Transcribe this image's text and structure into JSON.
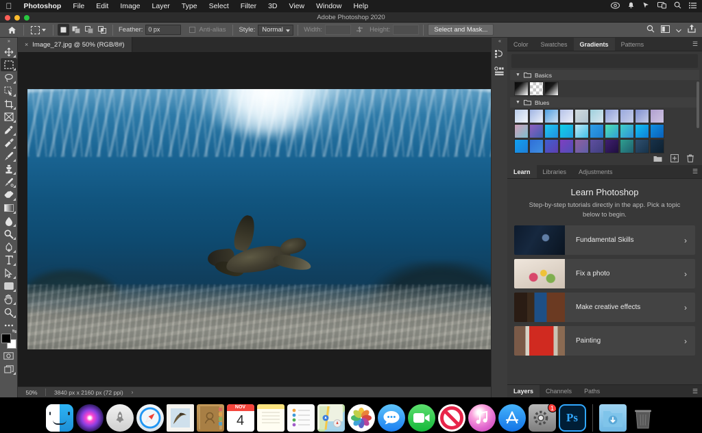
{
  "macmenu": {
    "apple_icon": "apple-icon",
    "items": [
      {
        "label": "Photoshop",
        "bold": true
      },
      {
        "label": "File",
        "bold": false
      },
      {
        "label": "Edit",
        "bold": false
      },
      {
        "label": "Image",
        "bold": false
      },
      {
        "label": "Layer",
        "bold": false
      },
      {
        "label": "Type",
        "bold": false
      },
      {
        "label": "Select",
        "bold": false
      },
      {
        "label": "Filter",
        "bold": false
      },
      {
        "label": "3D",
        "bold": false
      },
      {
        "label": "View",
        "bold": false
      },
      {
        "label": "Window",
        "bold": false
      },
      {
        "label": "Help",
        "bold": false
      }
    ],
    "status_icons": [
      "creative-cloud-icon",
      "notification-bell-icon",
      "control-center-icon",
      "screen-mirroring-icon",
      "spotlight-search-icon",
      "notification-center-icon"
    ]
  },
  "titlebar": {
    "title": "Adobe Photoshop 2020",
    "buttons": [
      "close-button",
      "minimize-button",
      "zoom-button"
    ]
  },
  "optionsbar": {
    "home_icon": "home-icon",
    "tool_icon": "rectangular-marquee-icon",
    "selection_modes": [
      "new-selection",
      "add-to-selection",
      "subtract-from-selection",
      "intersect-selection"
    ],
    "feather_label": "Feather:",
    "feather_value": "0 px",
    "antialias_label": "Anti-alias",
    "style_label": "Style:",
    "style_value": "Normal",
    "width_label": "Width:",
    "width_value": "",
    "swap_icon": "swap-dimensions-icon",
    "height_label": "Height:",
    "height_value": "",
    "select_and_mask": "Select and Mask...",
    "right_icons": [
      "search-icon",
      "workspace-icon",
      "chevron-down-icon",
      "share-icon"
    ]
  },
  "toolbar": {
    "tools": [
      {
        "name": "move-tool",
        "active": false
      },
      {
        "name": "rectangular-marquee-tool",
        "active": true
      },
      {
        "name": "lasso-tool",
        "active": false
      },
      {
        "name": "quick-selection-tool",
        "active": false
      },
      {
        "name": "crop-tool",
        "active": false
      },
      {
        "name": "frame-tool",
        "active": false
      },
      {
        "name": "eyedropper-tool",
        "active": false
      },
      {
        "name": "spot-healing-brush-tool",
        "active": false
      },
      {
        "name": "brush-tool",
        "active": false
      },
      {
        "name": "clone-stamp-tool",
        "active": false
      },
      {
        "name": "history-brush-tool",
        "active": false
      },
      {
        "name": "eraser-tool",
        "active": false
      },
      {
        "name": "gradient-tool",
        "active": false
      },
      {
        "name": "blur-tool",
        "active": false
      },
      {
        "name": "dodge-tool",
        "active": false
      },
      {
        "name": "pen-tool",
        "active": false
      },
      {
        "name": "type-tool",
        "active": false
      },
      {
        "name": "path-selection-tool",
        "active": false
      },
      {
        "name": "rectangle-tool",
        "active": false
      },
      {
        "name": "hand-tool",
        "active": false
      },
      {
        "name": "zoom-tool",
        "active": false
      },
      {
        "name": "edit-toolbar-tool",
        "active": false
      }
    ],
    "foreground_color": "#000000",
    "background_color": "#ffffff",
    "quickmask_icon": "quick-mask-icon",
    "screenmode_icon": "screen-mode-icon"
  },
  "document": {
    "tab_title": "Image_27.jpg @ 50% (RGB/8#)",
    "close_icon": "close-tab-icon"
  },
  "statusbar": {
    "zoom": "50%",
    "dimensions": "3840 px x 2160 px (72 ppi)",
    "arrow": "›"
  },
  "canvas": {
    "image_description": "Underwater photo of a sea turtle swimming above a sandy seabed with sun rays through the water surface"
  },
  "rail": {
    "icons": [
      "history-panel-icon",
      "actions-panel-icon"
    ]
  },
  "gradients_panel": {
    "tabs": [
      {
        "label": "Color",
        "active": false
      },
      {
        "label": "Swatches",
        "active": false
      },
      {
        "label": "Gradients",
        "active": true
      },
      {
        "label": "Patterns",
        "active": false
      }
    ],
    "menu_icon": "panel-menu-icon",
    "groups": [
      {
        "name": "Basics",
        "folder_icon": "folder-icon",
        "collapse_icon": "chevron-down-icon",
        "swatches": [
          "linear-gradient(135deg,#0b0b0b 0%,#111 30%,#ffffff 100%)",
          "repeating-conic-gradient(#cfcfcf 0% 25%, #ffffff 0% 50%) 0 0/9px 9px",
          "linear-gradient(135deg,#0b0b0b 0%,#1a1a1a 42%,#ffffff 100%)"
        ]
      },
      {
        "name": "Blues",
        "folder_icon": "folder-icon",
        "collapse_icon": "chevron-down-icon",
        "swatches": [
          "linear-gradient(135deg,#b9cbe8,#f3f7fb)",
          "linear-gradient(135deg,#9fb4e2,#eef2fb)",
          "linear-gradient(135deg,#4f9fe0,#cfe0f3)",
          "linear-gradient(135deg,#b6c3e8,#eceff9)",
          "linear-gradient(135deg,#cfd9dd,#b2c4cf)",
          "linear-gradient(135deg,#9fd0dd,#d8e6ef)",
          "linear-gradient(135deg,#8f9fd8,#cfd7ef)",
          "linear-gradient(135deg,#9aa9dd,#c6cde9)",
          "linear-gradient(135deg,#7f8fcf,#c4cbe6)",
          "linear-gradient(135deg,#b09fd0,#cfc4e2)",
          "linear-gradient(135deg,#cf9fb8,#7fbfcf)",
          "linear-gradient(135deg,#8f5fc0,#3f5fb0)",
          "linear-gradient(135deg,#1fc8f0,#1f8fe0)",
          "linear-gradient(135deg,#10cfe8,#1fa0e0)",
          "linear-gradient(135deg,#bfe8f5,#3fc0e8)",
          "linear-gradient(135deg,#2f9fe8,#1f7fd0)",
          "linear-gradient(135deg,#4fe0b0,#2f9fd8)",
          "linear-gradient(135deg,#3fd0c8,#2f90d8)",
          "linear-gradient(135deg,#10c0f0,#0f7fd8)",
          "linear-gradient(135deg,#0f8fe0,#0a5fb8)",
          "linear-gradient(135deg,#10a0f0,#1f7fd8)",
          "linear-gradient(135deg,#2f6fd8,#3f8fe0)",
          "linear-gradient(135deg,#3f5fd0,#5f3fb0)",
          "linear-gradient(135deg,#7f3fc0,#4f4fb8)",
          "linear-gradient(135deg,#8f5f9f,#5f5fa8)",
          "linear-gradient(135deg,#5f4f9f,#3f3f7f)",
          "linear-gradient(135deg,#3f1f6f,#1f0f3f)",
          "linear-gradient(135deg,#2f9f8f,#1f5f6f)",
          "linear-gradient(135deg,#2f4f6f,#17334a)",
          "linear-gradient(135deg,#17324a,#0d1f2e)"
        ]
      }
    ],
    "footer_icons": [
      "new-group-icon",
      "new-gradient-icon",
      "delete-icon"
    ]
  },
  "learn_panel": {
    "tabs": [
      {
        "label": "Learn",
        "active": true
      },
      {
        "label": "Libraries",
        "active": false
      },
      {
        "label": "Adjustments",
        "active": false
      }
    ],
    "menu_icon": "panel-menu-icon",
    "title": "Learn Photoshop",
    "subtitle": "Step-by-step tutorials directly in the app. Pick a topic below to begin.",
    "cards": [
      {
        "title": "Fundamental Skills",
        "thumb": "th1",
        "chevron": "›"
      },
      {
        "title": "Fix a photo",
        "thumb": "th2",
        "chevron": "›"
      },
      {
        "title": "Make creative effects",
        "thumb": "th3",
        "chevron": "›"
      },
      {
        "title": "Painting",
        "thumb": "th4",
        "chevron": "›"
      }
    ]
  },
  "layers_panel": {
    "tabs": [
      {
        "label": "Layers",
        "active": true
      },
      {
        "label": "Channels",
        "active": false
      },
      {
        "label": "Paths",
        "active": false
      }
    ],
    "menu_icon": "panel-menu-icon"
  },
  "dock": {
    "items": [
      {
        "name": "finder",
        "label": "Finder",
        "running": true
      },
      {
        "name": "siri",
        "label": "Siri",
        "running": false
      },
      {
        "name": "launchpad",
        "label": "Launchpad",
        "running": false
      },
      {
        "name": "safari",
        "label": "Safari",
        "running": false
      },
      {
        "name": "mail",
        "label": "Mail",
        "running": false
      },
      {
        "name": "contacts",
        "label": "Contacts",
        "running": false
      },
      {
        "name": "calendar",
        "label": "Calendar",
        "running": false
      },
      {
        "name": "notes",
        "label": "Notes",
        "running": false
      },
      {
        "name": "reminders",
        "label": "Reminders",
        "running": false
      },
      {
        "name": "maps",
        "label": "Maps",
        "running": false
      },
      {
        "name": "photos",
        "label": "Photos",
        "running": false
      },
      {
        "name": "messages",
        "label": "Messages",
        "running": false
      },
      {
        "name": "facetime",
        "label": "FaceTime",
        "running": false
      },
      {
        "name": "restricted",
        "label": "Restricted",
        "running": false
      },
      {
        "name": "itunes",
        "label": "iTunes",
        "running": false
      },
      {
        "name": "appstore",
        "label": "App Store",
        "running": false
      },
      {
        "name": "system-preferences",
        "label": "System Preferences",
        "running": false,
        "badge": "1"
      },
      {
        "name": "photoshop",
        "label": "Ps",
        "running": true
      }
    ],
    "calendar_month": "NOV",
    "calendar_day": "4",
    "right_items": [
      {
        "name": "downloads-folder",
        "label": "Downloads"
      },
      {
        "name": "trash",
        "label": "Trash"
      }
    ]
  },
  "colors": {
    "accent": "#31a8ff",
    "panel_bg": "#383838",
    "toolbar_bg": "#535353",
    "canvas_bg": "#1c1c1c",
    "badge_red": "#fc3d39"
  }
}
